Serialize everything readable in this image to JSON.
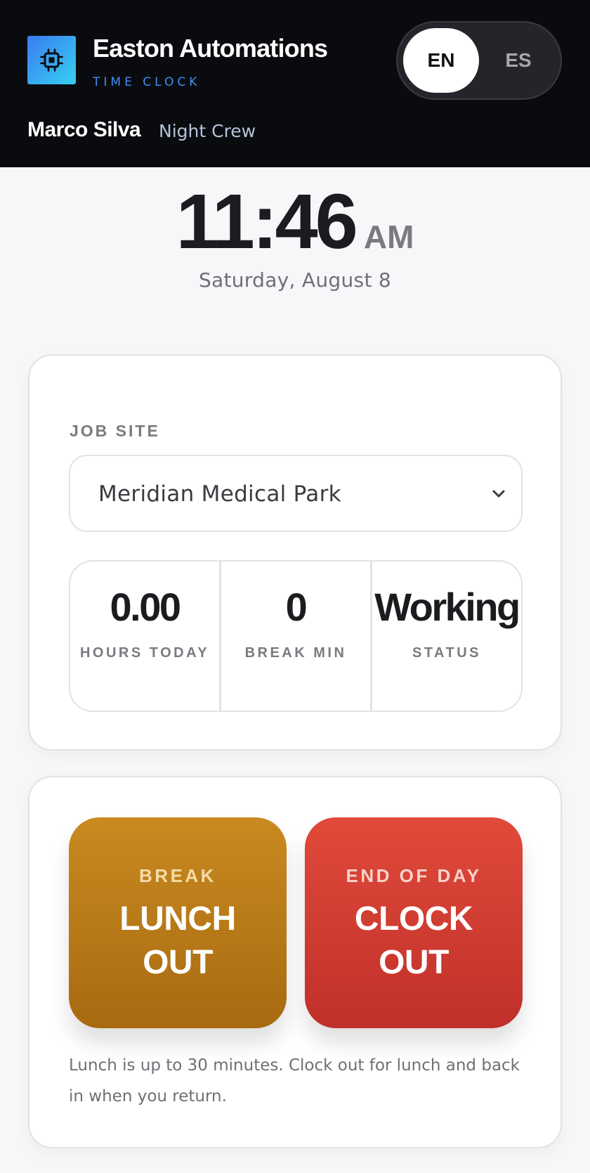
{
  "header": {
    "brand": "Easton Automations",
    "subtitle": "TIME CLOCK",
    "logo_icon": "chip-icon",
    "languages": [
      {
        "label": "EN",
        "active": true
      },
      {
        "label": "ES",
        "active": false
      }
    ],
    "user_name": "Marco Silva",
    "crew": "Night Crew"
  },
  "clock": {
    "time": "11:46",
    "ampm": "AM",
    "date": "Saturday, August 8"
  },
  "job": {
    "label": "JOB SITE",
    "selected": "Meridian Medical Park"
  },
  "stats": [
    {
      "value": "0.00",
      "label": "HOURS TODAY"
    },
    {
      "value": "0",
      "label": "BREAK MIN"
    },
    {
      "value": "Working",
      "label": "STATUS"
    }
  ],
  "actions": {
    "lunch": {
      "kicker": "BREAK",
      "label": "LUNCH\nOUT"
    },
    "clock": {
      "kicker": "END OF DAY",
      "label": "CLOCK\nOUT"
    },
    "help": "Lunch is up to 30 minutes. Clock out for lunch and back in when you return."
  },
  "colors": {
    "header_bg": "#0a0b0f",
    "accent_blue": "#3f8ef2",
    "lunch_btn": "#b87a18",
    "clock_btn": "#d33e32"
  }
}
